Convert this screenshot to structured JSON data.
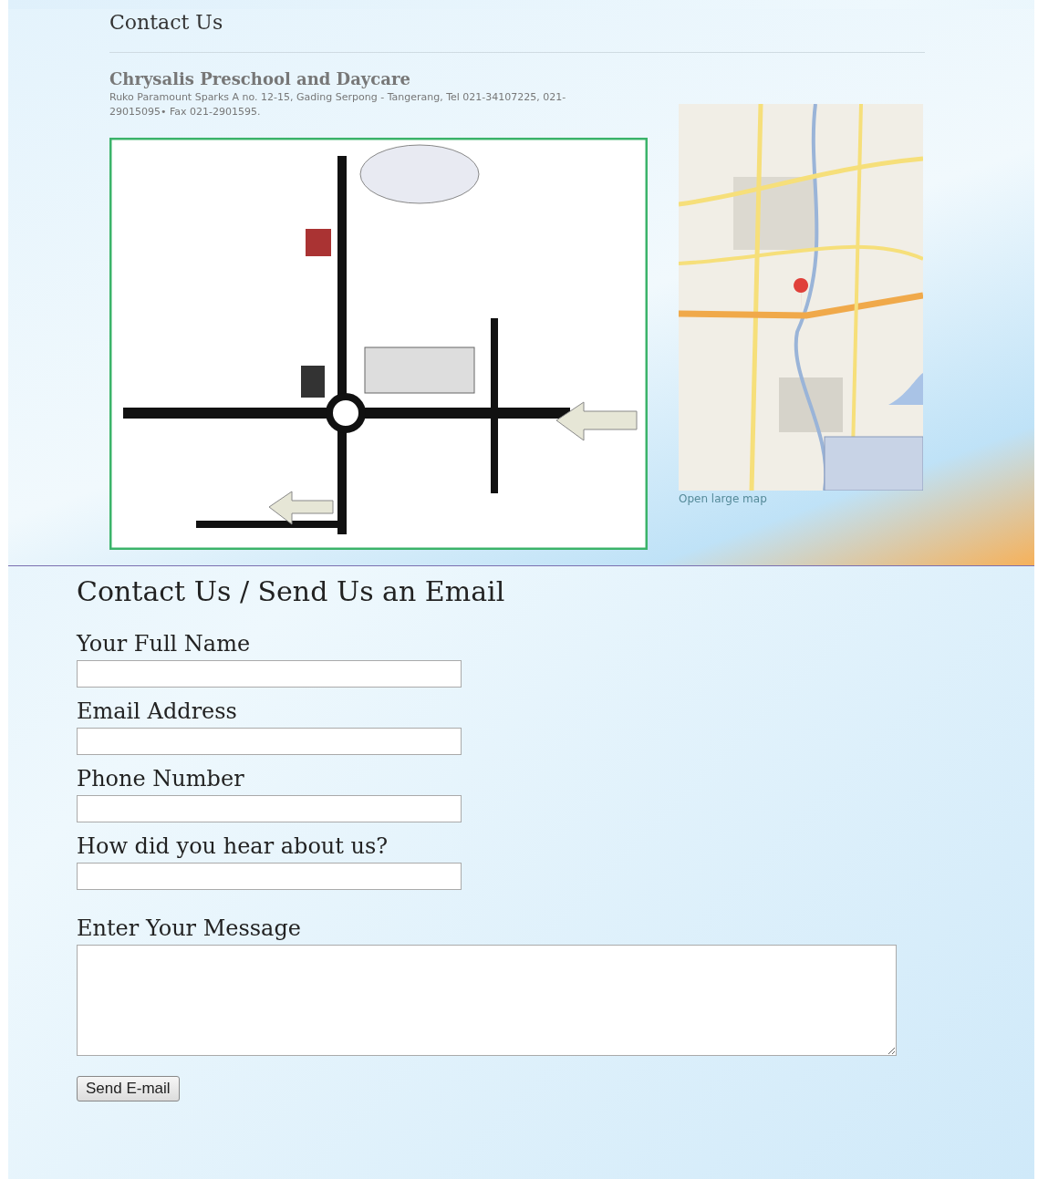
{
  "header": {
    "title": "Contact Us"
  },
  "location": {
    "name": "Chrysalis Preschool and Daycare",
    "address": "Ruko Paramount Sparks A no. 12-15, Gading Serpong - Tangerang, Tel 021-34107225, 021-29015095• Fax 021-2901595.",
    "map": {
      "kind": "picture",
      "link": "Open large map"
    }
  },
  "form": {
    "title": "Contact Us / Send Us an Email",
    "fields": [
      {
        "label": "Your Full Name",
        "kind": "text"
      },
      {
        "label": "Email Address",
        "kind": "text"
      },
      {
        "label": "Phone Number",
        "kind": "text"
      },
      {
        "label": "How did you hear about us?",
        "kind": "text"
      },
      {
        "label": "Enter Your Message",
        "kind": "textarea"
      }
    ],
    "submit": "Send E-mail"
  }
}
